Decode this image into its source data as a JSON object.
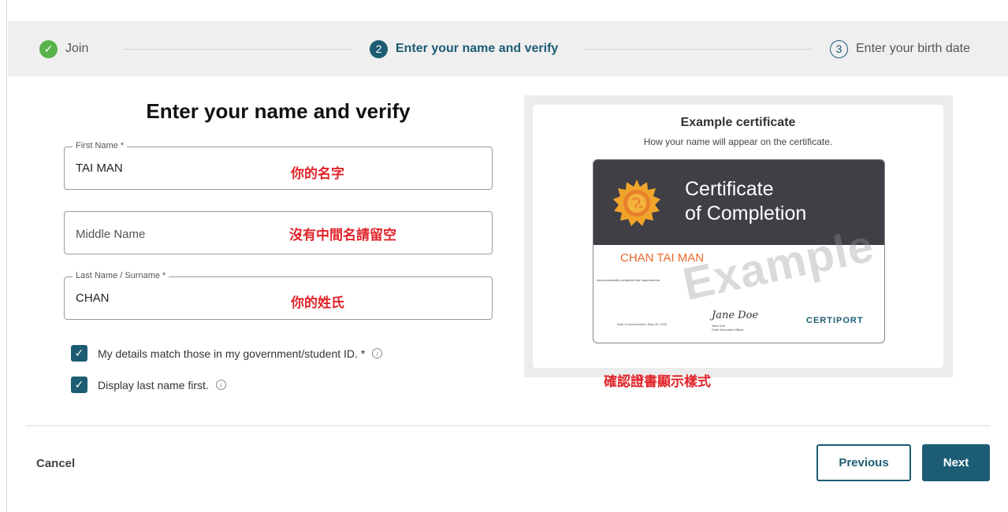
{
  "stepper": {
    "steps": [
      {
        "number": "✓",
        "label": "Join"
      },
      {
        "number": "2",
        "label": "Enter your name and verify"
      },
      {
        "number": "3",
        "label": "Enter your birth date"
      }
    ]
  },
  "form": {
    "title": "Enter your name and verify",
    "first_name": {
      "label": "First Name *",
      "value": "TAI MAN"
    },
    "middle_name": {
      "placeholder": "Middle Name"
    },
    "last_name": {
      "label": "Last Name / Surname *",
      "value": "CHAN"
    },
    "checks": [
      {
        "label": "My details match those in my government/student ID. *",
        "checked": true
      },
      {
        "label": "Display last name first.",
        "checked": true
      }
    ]
  },
  "annotations": {
    "first_name_note": "你的名字",
    "middle_name_note": "沒有中間名請留空",
    "last_name_note": "你的姓氏",
    "certificate_note": "確認證書顯示樣式"
  },
  "certificate": {
    "heading": "Example certificate",
    "subheading": "How your name will appear on the certificate.",
    "title_line1": "Certificate",
    "title_line2": "of Completion",
    "name": "CHAN TAI MAN",
    "body_text": "has successfully completed the requirements",
    "date_text": "Date of achievement: May 26, 2020",
    "signature": "Jane Doe",
    "signer_name": "Jane Doe",
    "signer_title": "Chief Executive Officer",
    "logo": "CERTIPORT",
    "watermark": "Example"
  },
  "footer": {
    "cancel": "Cancel",
    "previous": "Previous",
    "next": "Next"
  },
  "colors": {
    "primary": "#1c5d74",
    "success": "#57b34a",
    "annotation": "#e0242a",
    "cert_name": "#e8672b"
  },
  "icons": {
    "check": "check-icon",
    "info": "info-icon"
  }
}
